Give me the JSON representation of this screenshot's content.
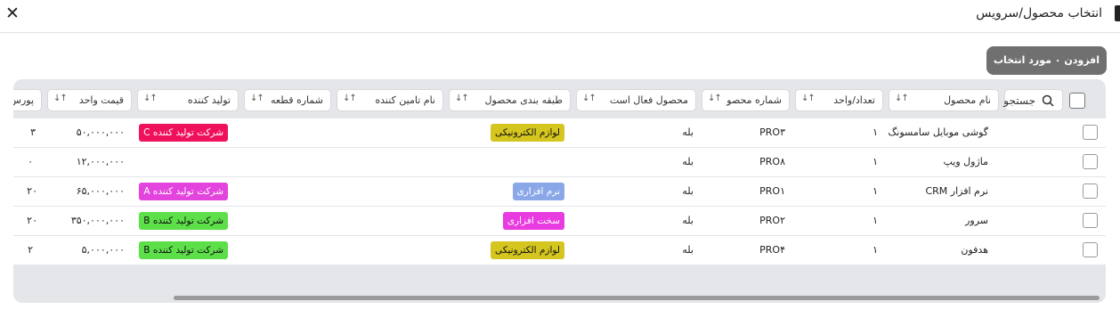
{
  "window": {
    "title": "انتخاب محصول/سرویس",
    "add_selected_label": "افزودن ۰ مورد انتخاب شده"
  },
  "table": {
    "search_label": "جستجو",
    "headers": {
      "product_name": "نام محصول",
      "qty_unit": "تعداد/واحد",
      "product_number": "شماره محصو",
      "is_active": "محصول فعال است",
      "category": "طبقه بندی محصول",
      "supplier": "نام تامین کننده",
      "part_number": "شماره قطعه",
      "manufacturer": "تولید کننده",
      "unit_price": "قیمت واحد",
      "commission": "پورس"
    },
    "rows": [
      {
        "name": "گوشی موبایل سامسونگ",
        "qty": "۱",
        "number": "PRO۳",
        "active": "بله",
        "category": "لوازم الکترونیکی",
        "manufacturer": "شرکت تولید کننده C",
        "price": "۵۰,۰۰۰,۰۰۰",
        "commission": "۳"
      },
      {
        "name": "ماژول ویپ",
        "qty": "۱",
        "number": "PRO۸",
        "active": "بله",
        "category": "",
        "manufacturer": "",
        "price": "۱۲,۰۰۰,۰۰۰",
        "commission": "۰"
      },
      {
        "name": "نرم افزار CRM",
        "qty": "۱",
        "number": "PRO۱",
        "active": "بله",
        "category": "نرم افزاری",
        "manufacturer": "شرکت تولید کننده A",
        "price": "۶۵,۰۰۰,۰۰۰",
        "commission": "۲۰"
      },
      {
        "name": "سرور",
        "qty": "۱",
        "number": "PRO۲",
        "active": "بله",
        "category": "سخت افزاری",
        "manufacturer": "شرکت تولید کننده B",
        "price": "۳۵۰,۰۰۰,۰۰۰",
        "commission": "۲۰"
      },
      {
        "name": "هدفون",
        "qty": "۱",
        "number": "PRO۴",
        "active": "بله",
        "category": "لوازم الکترونیکی",
        "manufacturer": "شرکت تولید کننده B",
        "price": "۵,۰۰۰,۰۰۰",
        "commission": "۲"
      }
    ]
  },
  "colors": {
    "category_electronics": "#d4c51f",
    "category_software": "#8aa8e8",
    "category_hardware": "#e83be0",
    "manufacturer_a": "#e244dd",
    "manufacturer_b": "#5ddf4a",
    "manufacturer_c": "#f0115d"
  },
  "icons": {
    "close": "close-icon",
    "search": "search-icon",
    "sort": "sort-arrows-icon"
  }
}
